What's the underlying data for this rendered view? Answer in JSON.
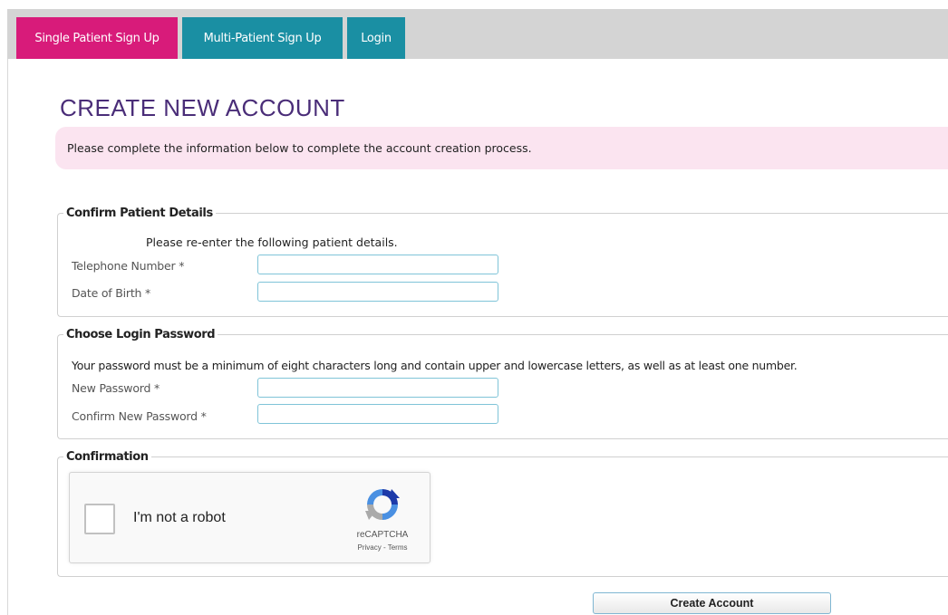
{
  "tabs": [
    {
      "label": "Single Patient Sign Up",
      "active": true
    },
    {
      "label": "Multi-Patient Sign Up",
      "active": false
    },
    {
      "label": "Login",
      "active": false
    }
  ],
  "page": {
    "title": "CREATE NEW ACCOUNT",
    "info": "Please complete the information below to complete the account creation process."
  },
  "patient_details": {
    "legend": "Confirm Patient Details",
    "instruction": "Please re-enter the following patient details.",
    "telephone_label": "Telephone Number *",
    "telephone_value": "",
    "dob_label": "Date of Birth *",
    "dob_value": ""
  },
  "password": {
    "legend": "Choose Login Password",
    "instruction": "Your password must be a minimum of eight characters long and contain upper and lowercase letters, as well as at least one number.",
    "new_label": "New Password *",
    "new_value": "",
    "confirm_label": "Confirm New Password *",
    "confirm_value": ""
  },
  "confirmation": {
    "legend": "Confirmation",
    "captcha_label": "I'm not a robot",
    "captcha_brand": "reCAPTCHA",
    "captcha_links": "Privacy - Terms",
    "captcha_icon": "recaptcha-logo"
  },
  "actions": {
    "submit_label": "Create Account"
  },
  "colors": {
    "tab_active": "#d81b7a",
    "tab_inactive": "#1a8fa3",
    "title": "#4a2d78",
    "info_bg": "#fbe4f0"
  }
}
